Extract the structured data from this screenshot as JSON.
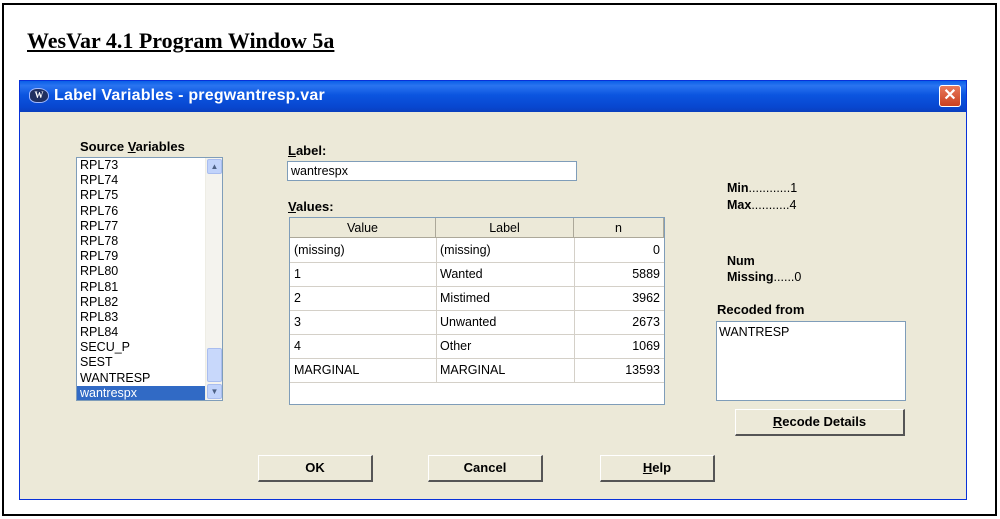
{
  "document": {
    "caption": "WesVar 4.1 Program Window 5a"
  },
  "window": {
    "title": "Label Variables - pregwantresp.var",
    "icon": "wesvar-app-icon",
    "close_label": "✕"
  },
  "source_variables": {
    "label_pre": "Source ",
    "label_key": "V",
    "label_post": "ariables",
    "items": [
      "RPL73",
      "RPL74",
      "RPL75",
      "RPL76",
      "RPL77",
      "RPL78",
      "RPL79",
      "RPL80",
      "RPL81",
      "RPL82",
      "RPL83",
      "RPL84",
      "SECU_P",
      "SEST",
      "WANTRESP",
      "wantrespx"
    ],
    "selected": "wantrespx"
  },
  "label_field": {
    "label_key": "L",
    "label_post": "abel:",
    "value": "wantrespx"
  },
  "values_grid": {
    "label_key": "V",
    "label_post": "alues:",
    "headers": [
      "Value",
      "Label",
      "n"
    ],
    "rows": [
      [
        "(missing)",
        "(missing)",
        "0"
      ],
      [
        "1",
        "Wanted",
        "5889"
      ],
      [
        "2",
        "Mistimed",
        "3962"
      ],
      [
        "3",
        "Unwanted",
        "2673"
      ],
      [
        "4",
        "Other",
        "1069"
      ],
      [
        "MARGINAL",
        "MARGINAL",
        "13593"
      ]
    ]
  },
  "stats": {
    "min_label": "Min",
    "min_dots": "............",
    "min_value": "1",
    "max_label": "Max",
    "max_dots": "...........",
    "max_value": "4",
    "num_label": "Num",
    "missing_label": "Missing",
    "missing_dots": "......",
    "missing_value": "0"
  },
  "recoded_from": {
    "label": "Recoded from",
    "value": "WANTRESP"
  },
  "buttons": {
    "recode_key": "R",
    "recode_post": "ecode Details",
    "ok": "OK",
    "cancel": "Cancel",
    "help_key": "H",
    "help_post": "elp"
  }
}
